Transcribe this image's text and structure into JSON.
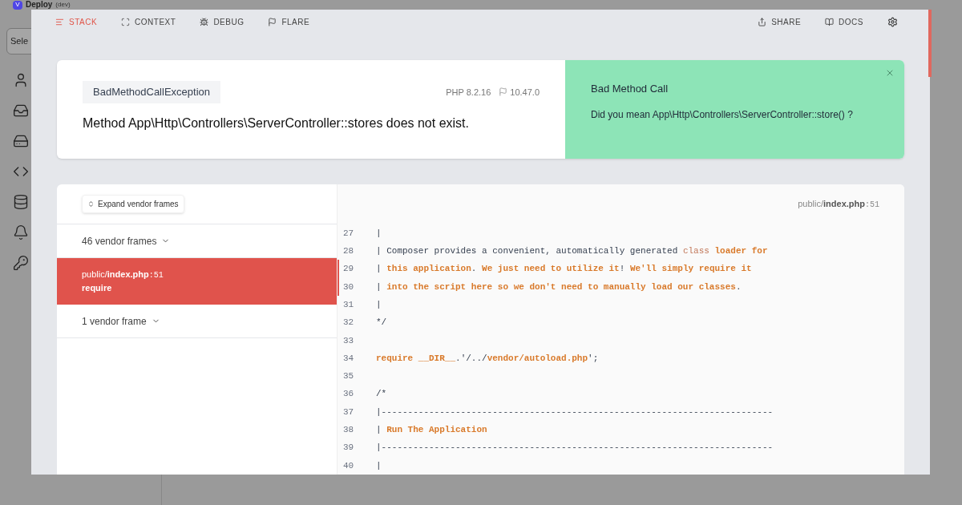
{
  "app": {
    "logo": "V",
    "title": "Deploy",
    "env": "(dev)",
    "select": "Sele"
  },
  "nav": {
    "tabs": [
      {
        "label": "STACK",
        "selected": true
      },
      {
        "label": "CONTEXT",
        "selected": false
      },
      {
        "label": "DEBUG",
        "selected": false
      },
      {
        "label": "FLARE",
        "selected": false
      }
    ],
    "actions": [
      {
        "label": "SHARE"
      },
      {
        "label": "DOCS"
      }
    ]
  },
  "error": {
    "exception": "BadMethodCallException",
    "php": "PHP 8.2.16",
    "laravel": "10.47.0",
    "message": "Method App\\Http\\Controllers\\ServerController::stores does not exist.",
    "solution": {
      "title": "Bad Method Call",
      "text": "Did you mean App\\Http\\Controllers\\ServerController::store() ?"
    }
  },
  "stack": {
    "expand_button": "Expand vendor frames",
    "frames": [
      {
        "kind": "vendor",
        "label": "46 vendor frames",
        "selected": false
      },
      {
        "kind": "app",
        "file_dir": "public/",
        "file_name": "index.php",
        "line": ":51",
        "method": "require",
        "selected": true
      },
      {
        "kind": "vendor",
        "label": "1 vendor frame",
        "selected": false
      }
    ],
    "code": {
      "file_dir": "public/",
      "file_name": "index.php",
      "line": ":51",
      "lines": [
        {
          "number": "27",
          "selected": false,
          "segments": [
            {
              "kind": "plain",
              "text": "|"
            }
          ]
        },
        {
          "number": "28",
          "selected": false,
          "segments": [
            {
              "kind": "plain",
              "text": "| Composer provides a convenient, automatically generated "
            },
            {
              "kind": "muted",
              "text": "class "
            },
            {
              "kind": "accent",
              "text": "loader for"
            }
          ]
        },
        {
          "number": "29",
          "selected": true,
          "segments": [
            {
              "kind": "plain",
              "text": "| "
            },
            {
              "kind": "accent",
              "text": "this application"
            },
            {
              "kind": "plain",
              "text": ". "
            },
            {
              "kind": "accent",
              "text": "We just need to utilize it"
            },
            {
              "kind": "plain",
              "text": "! "
            },
            {
              "kind": "accent",
              "text": "We'll simply require it"
            }
          ]
        },
        {
          "number": "30",
          "selected": true,
          "segments": [
            {
              "kind": "plain",
              "text": "| "
            },
            {
              "kind": "accent",
              "text": "into the script here so we don't need to manually load our classes"
            },
            {
              "kind": "plain",
              "text": "."
            }
          ]
        },
        {
          "number": "31",
          "selected": false,
          "segments": [
            {
              "kind": "plain",
              "text": "|"
            }
          ]
        },
        {
          "number": "32",
          "selected": false,
          "segments": [
            {
              "kind": "plain",
              "text": "*/"
            }
          ]
        },
        {
          "number": "33",
          "selected": false
        },
        {
          "number": "34",
          "selected": false,
          "segments": [
            {
              "kind": "accent",
              "text": "require __DIR__"
            },
            {
              "kind": "plain",
              "text": ".'/../"
            },
            {
              "kind": "accent",
              "text": "vendor/autoload.php"
            },
            {
              "kind": "plain",
              "text": "';"
            }
          ]
        },
        {
          "number": "35",
          "selected": false
        },
        {
          "number": "36",
          "selected": false,
          "segments": [
            {
              "kind": "plain",
              "text": "/*"
            }
          ]
        },
        {
          "number": "37",
          "selected": false,
          "segments": [
            {
              "kind": "plain",
              "text": "|--------------------------------------------------------------------------"
            }
          ]
        },
        {
          "number": "38",
          "selected": false,
          "segments": [
            {
              "kind": "plain",
              "text": "| "
            },
            {
              "kind": "accent",
              "text": "Run The Application"
            }
          ]
        },
        {
          "number": "39",
          "selected": false,
          "segments": [
            {
              "kind": "plain",
              "text": "|--------------------------------------------------------------------------"
            }
          ]
        },
        {
          "number": "40",
          "selected": false,
          "segments": [
            {
              "kind": "plain",
              "text": "|"
            }
          ]
        }
      ]
    }
  }
}
